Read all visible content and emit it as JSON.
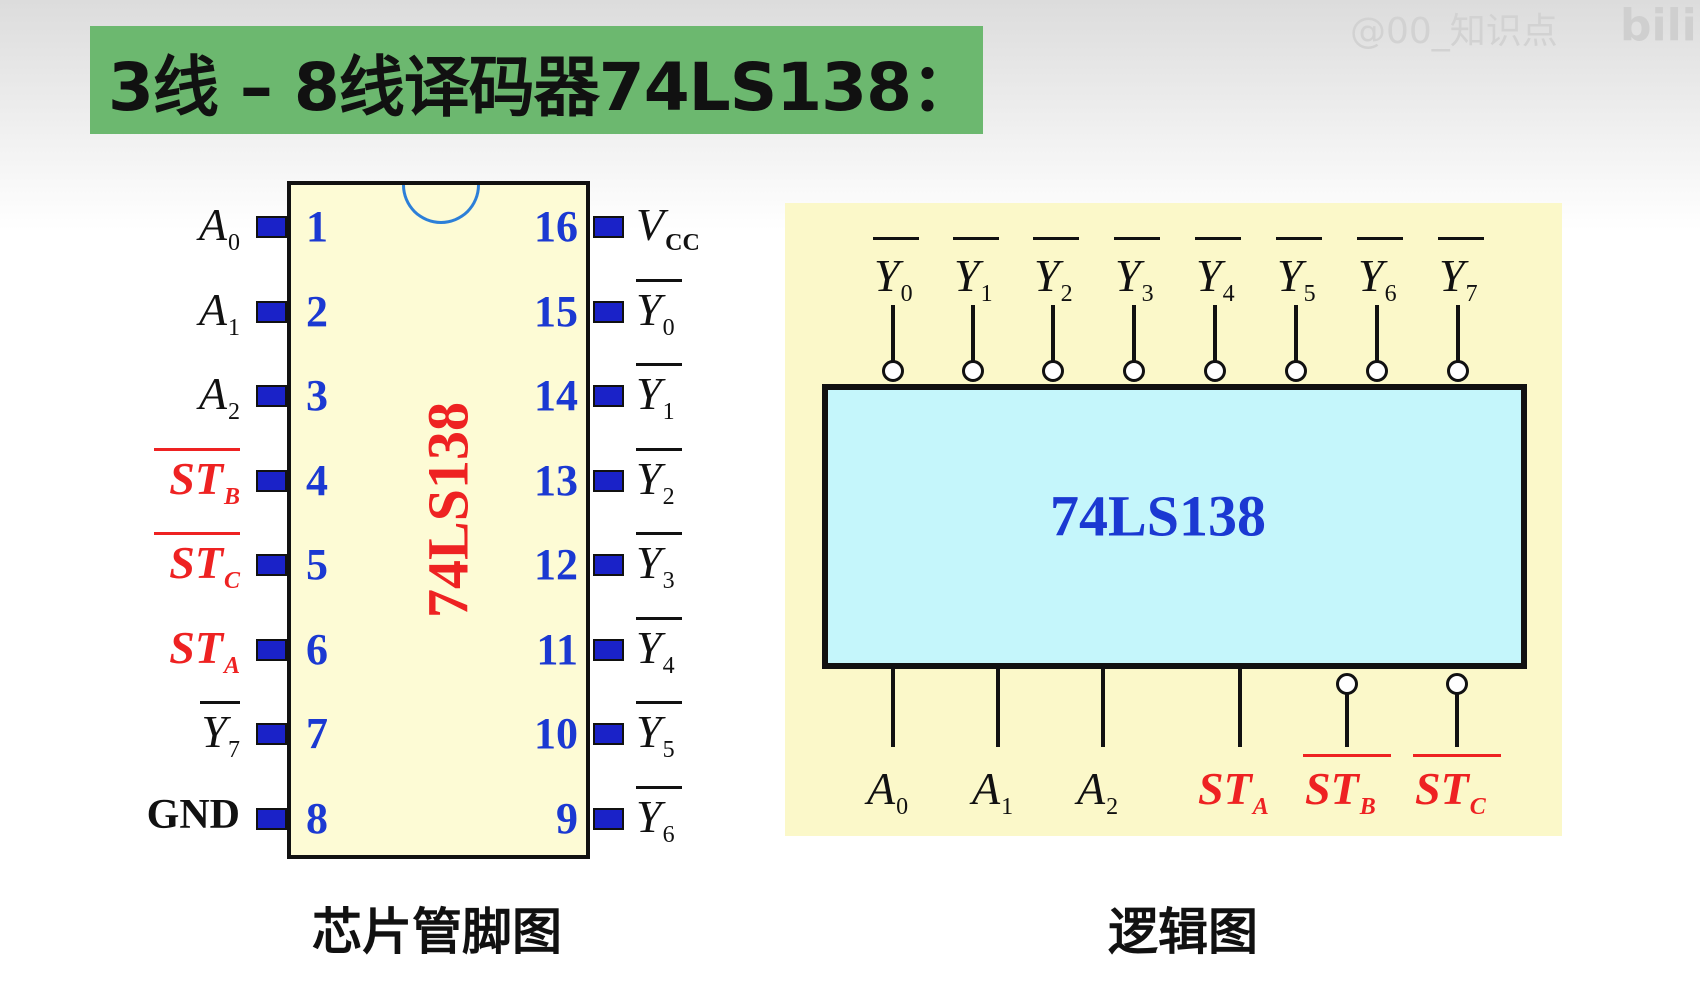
{
  "slide": {
    "title": "3线 – 8线译码器74LS138：",
    "watermark": "@00_知识点",
    "watermark_logo": "bili"
  },
  "pinout": {
    "chip_name": "74LS138",
    "caption": "芯片管脚图",
    "left_pins": [
      {
        "num": "1",
        "name": "A",
        "sub": "0",
        "inverted": false,
        "color": "#111111"
      },
      {
        "num": "2",
        "name": "A",
        "sub": "1",
        "inverted": false,
        "color": "#111111"
      },
      {
        "num": "3",
        "name": "A",
        "sub": "2",
        "inverted": false,
        "color": "#111111"
      },
      {
        "num": "4",
        "name": "ST",
        "sub": "B",
        "inverted": true,
        "color": "#ee2222"
      },
      {
        "num": "5",
        "name": "ST",
        "sub": "C",
        "inverted": true,
        "color": "#ee2222"
      },
      {
        "num": "6",
        "name": "ST",
        "sub": "A",
        "inverted": false,
        "color": "#ee2222"
      },
      {
        "num": "7",
        "name": "Y",
        "sub": "7",
        "inverted": true,
        "color": "#111111"
      },
      {
        "num": "8",
        "name": "GND",
        "sub": "",
        "inverted": false,
        "color": "#111111"
      }
    ],
    "right_pins": [
      {
        "num": "16",
        "name": "V",
        "sub": "CC",
        "inverted": false,
        "color": "#111111"
      },
      {
        "num": "15",
        "name": "Y",
        "sub": "0",
        "inverted": true,
        "color": "#111111"
      },
      {
        "num": "14",
        "name": "Y",
        "sub": "1",
        "inverted": true,
        "color": "#111111"
      },
      {
        "num": "13",
        "name": "Y",
        "sub": "2",
        "inverted": true,
        "color": "#111111"
      },
      {
        "num": "12",
        "name": "Y",
        "sub": "3",
        "inverted": true,
        "color": "#111111"
      },
      {
        "num": "11",
        "name": "Y",
        "sub": "4",
        "inverted": true,
        "color": "#111111"
      },
      {
        "num": "10",
        "name": "Y",
        "sub": "5",
        "inverted": true,
        "color": "#111111"
      },
      {
        "num": "9",
        "name": "Y",
        "sub": "6",
        "inverted": true,
        "color": "#111111"
      }
    ]
  },
  "logic": {
    "chip_name": "74LS138",
    "caption": "逻辑图",
    "outputs": [
      {
        "name": "Y",
        "sub": "0",
        "inverted": true
      },
      {
        "name": "Y",
        "sub": "1",
        "inverted": true
      },
      {
        "name": "Y",
        "sub": "2",
        "inverted": true
      },
      {
        "name": "Y",
        "sub": "3",
        "inverted": true
      },
      {
        "name": "Y",
        "sub": "4",
        "inverted": true
      },
      {
        "name": "Y",
        "sub": "5",
        "inverted": true
      },
      {
        "name": "Y",
        "sub": "6",
        "inverted": true
      },
      {
        "name": "Y",
        "sub": "7",
        "inverted": true
      }
    ],
    "inputs": [
      {
        "name": "A",
        "sub": "0",
        "inverted": false,
        "color": "#111111"
      },
      {
        "name": "A",
        "sub": "1",
        "inverted": false,
        "color": "#111111"
      },
      {
        "name": "A",
        "sub": "2",
        "inverted": false,
        "color": "#111111"
      },
      {
        "name": "ST",
        "sub": "A",
        "inverted": false,
        "color": "#ee2222"
      },
      {
        "name": "ST",
        "sub": "B",
        "inverted": true,
        "color": "#ee2222"
      },
      {
        "name": "ST",
        "sub": "C",
        "inverted": true,
        "color": "#ee2222"
      }
    ]
  }
}
